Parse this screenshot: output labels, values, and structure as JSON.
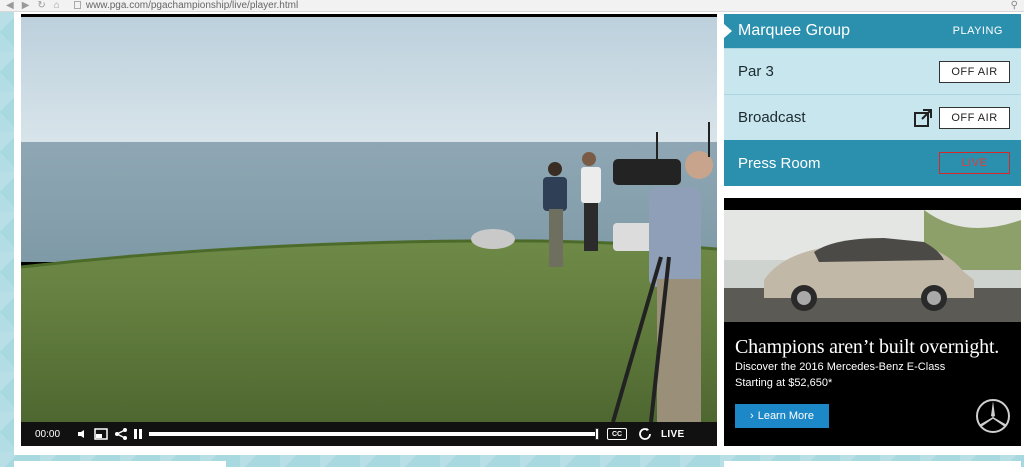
{
  "browser": {
    "url": "www.pga.com/pgachampionship/live/player.html",
    "nav_icons": [
      "back-icon",
      "forward-icon",
      "reload-icon",
      "home-icon"
    ],
    "zoom_icon": "magnifier-icon"
  },
  "player": {
    "time": "00:00",
    "live_label": "LIVE",
    "cc_label": "CC",
    "progress": 1.0
  },
  "channels": {
    "active": {
      "name": "Marquee Group",
      "status": "PLAYING"
    },
    "items": [
      {
        "name": "Par 3",
        "status": "OFF AIR"
      },
      {
        "name": "Broadcast",
        "status": "OFF AIR"
      },
      {
        "name": "Press Room",
        "status": "LIVE"
      }
    ]
  },
  "ad": {
    "headline": "Champions aren’t built overnight.",
    "line1": "Discover the 2016 Mercedes-Benz E-Class",
    "line2": "Starting at $52,650*",
    "cta": "Learn More"
  },
  "colors": {
    "accent": "#2b8fae",
    "inactive_row": "#c7e6ee",
    "live_red": "#e23c3c",
    "cta_blue": "#1d88c8"
  }
}
